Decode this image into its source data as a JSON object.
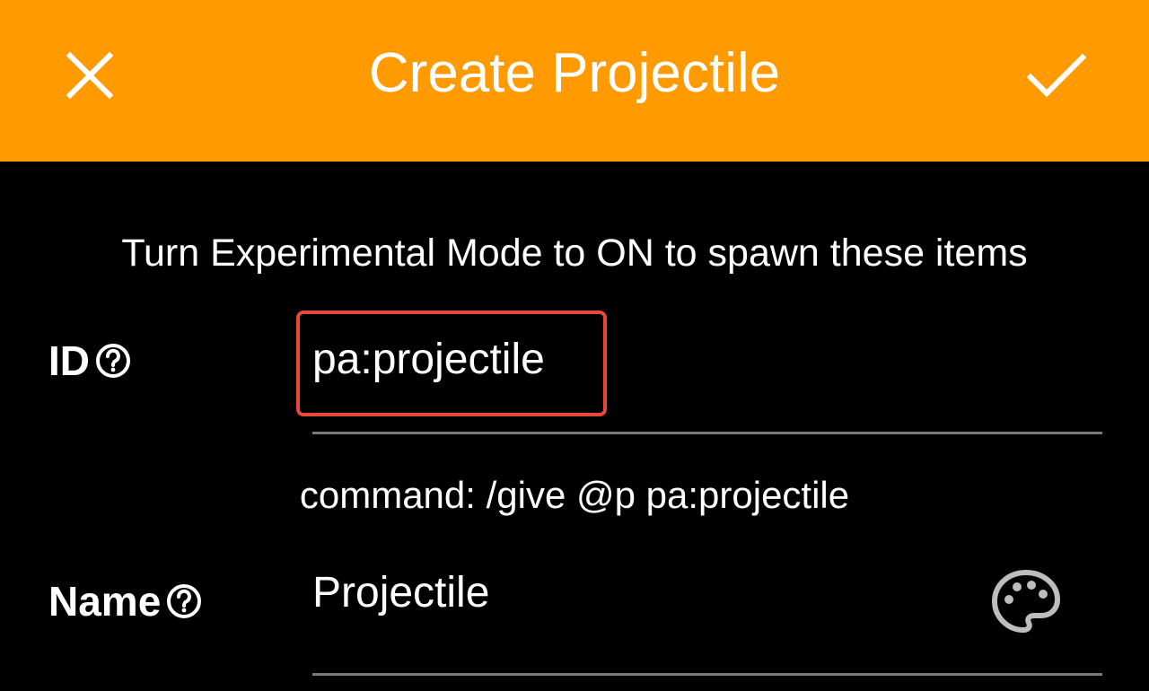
{
  "appbar": {
    "title": "Create Projectile",
    "background_color": "#ff9a00",
    "close_icon": "close-icon",
    "confirm_icon": "check-icon"
  },
  "notice": "Turn Experimental Mode to ON to spawn these items",
  "fields": {
    "id": {
      "label": "ID",
      "help_icon": "help-circle-icon",
      "value": "pa:projectile",
      "highlight_color": "#e8473b"
    },
    "command": "command: /give @p pa:projectile",
    "name": {
      "label": "Name",
      "help_icon": "help-circle-icon",
      "value": "Projectile",
      "palette_icon": "palette-icon"
    }
  }
}
